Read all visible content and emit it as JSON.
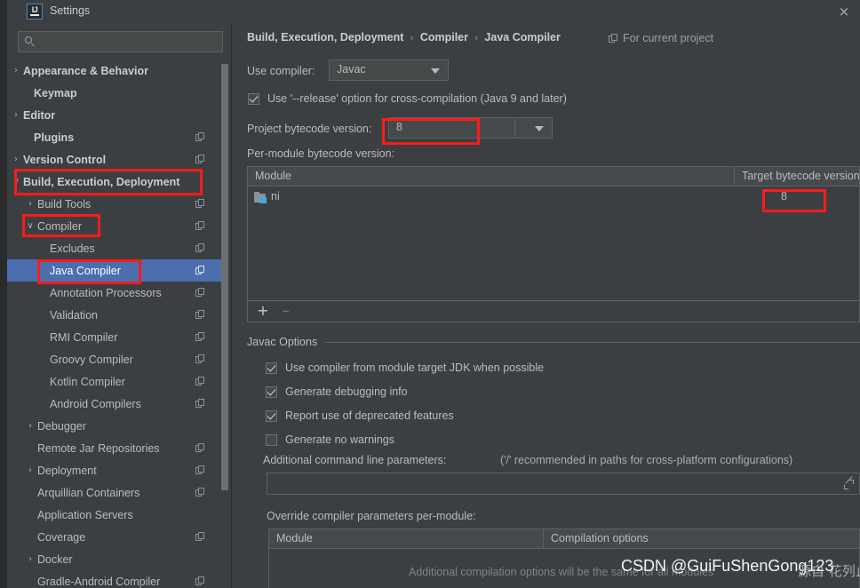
{
  "window": {
    "title": "Settings",
    "logo_text": "IJ",
    "close_label": "×"
  },
  "search": {
    "value": "",
    "placeholder": ""
  },
  "sidebar": {
    "items": [
      {
        "label": "Appearance & Behavior",
        "arrow": "›",
        "indent": 18,
        "bold": true,
        "copy": false,
        "selected": false
      },
      {
        "label": "Keymap",
        "arrow": "",
        "indent": 30,
        "bold": true,
        "copy": false,
        "selected": false
      },
      {
        "label": "Editor",
        "arrow": "›",
        "indent": 18,
        "bold": true,
        "copy": false,
        "selected": false
      },
      {
        "label": "Plugins",
        "arrow": "",
        "indent": 30,
        "bold": true,
        "copy": true,
        "selected": false
      },
      {
        "label": "Version Control",
        "arrow": "›",
        "indent": 18,
        "bold": true,
        "copy": true,
        "selected": false
      },
      {
        "label": "Build, Execution, Deployment",
        "arrow": "∨",
        "indent": 18,
        "bold": true,
        "copy": false,
        "selected": false
      },
      {
        "label": "Build Tools",
        "arrow": "›",
        "indent": 34,
        "bold": false,
        "copy": true,
        "selected": false
      },
      {
        "label": "Compiler",
        "arrow": "∨",
        "indent": 34,
        "bold": false,
        "copy": true,
        "selected": false
      },
      {
        "label": "Excludes",
        "arrow": "",
        "indent": 48,
        "bold": false,
        "copy": true,
        "selected": false
      },
      {
        "label": "Java Compiler",
        "arrow": "",
        "indent": 48,
        "bold": false,
        "copy": true,
        "selected": true
      },
      {
        "label": "Annotation Processors",
        "arrow": "",
        "indent": 48,
        "bold": false,
        "copy": true,
        "selected": false
      },
      {
        "label": "Validation",
        "arrow": "",
        "indent": 48,
        "bold": false,
        "copy": true,
        "selected": false
      },
      {
        "label": "RMI Compiler",
        "arrow": "",
        "indent": 48,
        "bold": false,
        "copy": true,
        "selected": false
      },
      {
        "label": "Groovy Compiler",
        "arrow": "",
        "indent": 48,
        "bold": false,
        "copy": true,
        "selected": false
      },
      {
        "label": "Kotlin Compiler",
        "arrow": "",
        "indent": 48,
        "bold": false,
        "copy": true,
        "selected": false
      },
      {
        "label": "Android Compilers",
        "arrow": "",
        "indent": 48,
        "bold": false,
        "copy": true,
        "selected": false
      },
      {
        "label": "Debugger",
        "arrow": "›",
        "indent": 34,
        "bold": false,
        "copy": false,
        "selected": false
      },
      {
        "label": "Remote Jar Repositories",
        "arrow": "",
        "indent": 34,
        "bold": false,
        "copy": true,
        "selected": false
      },
      {
        "label": "Deployment",
        "arrow": "›",
        "indent": 34,
        "bold": false,
        "copy": true,
        "selected": false
      },
      {
        "label": "Arquillian Containers",
        "arrow": "",
        "indent": 34,
        "bold": false,
        "copy": true,
        "selected": false
      },
      {
        "label": "Application Servers",
        "arrow": "",
        "indent": 34,
        "bold": false,
        "copy": false,
        "selected": false
      },
      {
        "label": "Coverage",
        "arrow": "",
        "indent": 34,
        "bold": false,
        "copy": true,
        "selected": false
      },
      {
        "label": "Docker",
        "arrow": "›",
        "indent": 34,
        "bold": false,
        "copy": false,
        "selected": false
      },
      {
        "label": "Gradle-Android Compiler",
        "arrow": "",
        "indent": 34,
        "bold": false,
        "copy": true,
        "selected": false
      }
    ]
  },
  "main": {
    "breadcrumb": {
      "part1": "Build, Execution, Deployment",
      "sep1": "›",
      "part2": "Compiler",
      "sep2": "›",
      "part3": "Java Compiler"
    },
    "scope_label": "For current project",
    "use_compiler": {
      "label": "Use compiler:",
      "value": "Javac"
    },
    "release_option": {
      "label": "Use '--release' option for cross-compilation (Java 9 and later)",
      "checked": true
    },
    "project_bytecode": {
      "label": "Project bytecode version:",
      "value": "8"
    },
    "per_module": {
      "label": "Per-module bytecode version:",
      "col_module": "Module",
      "col_target": "Target bytecode version",
      "rows": [
        {
          "module": "ni",
          "target": "8"
        }
      ],
      "add_btn": "+",
      "remove_btn": "–"
    },
    "javac_options": {
      "title": "Javac Options",
      "checkboxes": [
        {
          "label": "Use compiler from module target JDK when possible",
          "checked": true
        },
        {
          "label": "Generate debugging info",
          "checked": true
        },
        {
          "label": "Report use of deprecated features",
          "checked": true
        },
        {
          "label": "Generate no warnings",
          "checked": false
        }
      ],
      "params_label": "Additional command line parameters:",
      "params_hint": "('/' recommended in paths for cross-platform configurations)",
      "params_value": ""
    },
    "override_section": {
      "label": "Override compiler parameters per-module:",
      "col_module": "Module",
      "col_options": "Compilation options",
      "empty_note": "Additional compilation options will be the same for all modules"
    }
  },
  "watermark": {
    "text": "CSDN @GuiFuShenGong123",
    "cjk": "源自 花列止"
  },
  "colors": {
    "annotation": "#ff1a1a",
    "selection": "#4b6eaf",
    "background": "#3c3f41"
  }
}
